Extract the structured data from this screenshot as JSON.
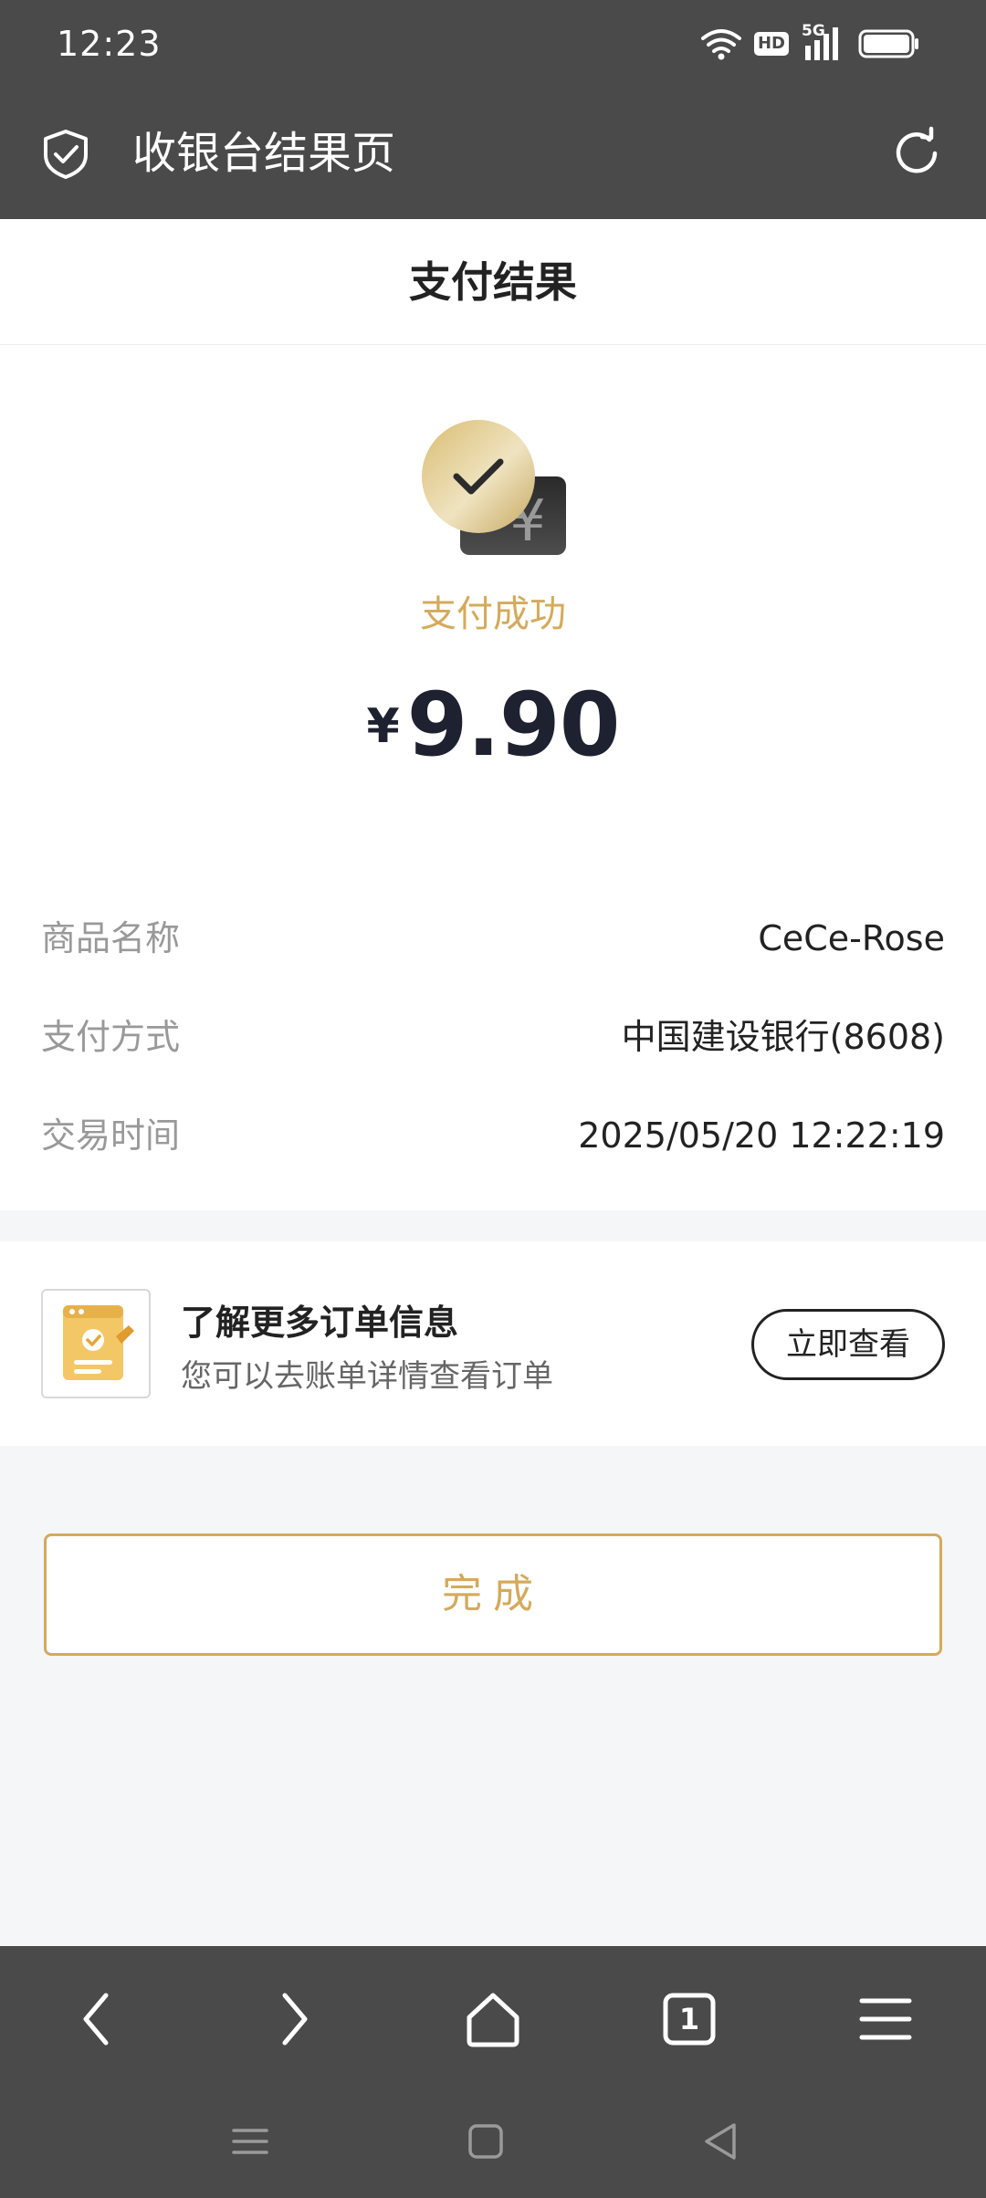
{
  "status_bar": {
    "time": "12:23",
    "badges": {
      "hd": "HD",
      "network": "5G"
    },
    "icons": [
      "wifi-icon",
      "signal-icon",
      "battery-icon"
    ]
  },
  "app_bar": {
    "title": "收银台结果页",
    "icons": [
      "shield-check-icon",
      "refresh-icon"
    ]
  },
  "page": {
    "title": "支付结果"
  },
  "result": {
    "status_text": "支付成功",
    "currency_symbol": "¥",
    "amount": "9.90",
    "details": [
      {
        "label": "商品名称",
        "value": "CeCe-Rose"
      },
      {
        "label": "支付方式",
        "value": "中国建设银行(8608)"
      },
      {
        "label": "交易时间",
        "value": "2025/05/20 12:22:19"
      }
    ]
  },
  "order_info": {
    "title": "了解更多订单信息",
    "subtitle": "您可以去账单详情查看订单",
    "button_label": "立即查看"
  },
  "done_button": {
    "label": "完成"
  },
  "browser_nav": {
    "tab_count": "1",
    "icons": [
      "back-icon",
      "forward-icon",
      "home-icon",
      "tabs-icon",
      "menu-icon"
    ]
  },
  "system_nav": {
    "icons": [
      "recents-icon",
      "home-square-icon",
      "back-triangle-icon"
    ]
  },
  "colors": {
    "bar_bg": "#4a4a4a",
    "accent_gold": "#d4aa5b",
    "amount_text": "#1e2130",
    "page_bg": "#f5f6f8"
  }
}
